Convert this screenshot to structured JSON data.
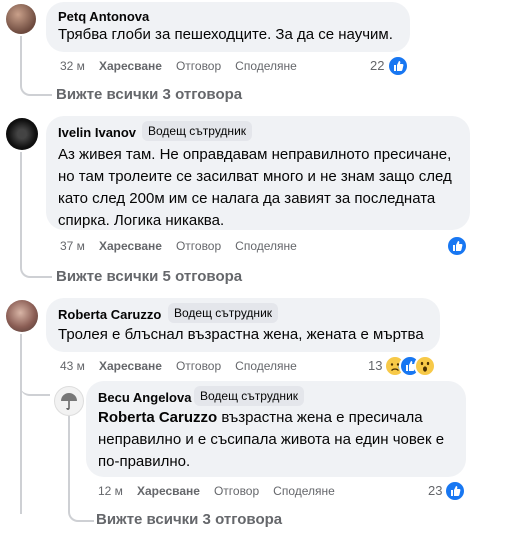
{
  "comments": [
    {
      "author": "Petq Antonova",
      "text": "Трябва глоби за пешеходците. За да се научим.",
      "time": "32 м",
      "like": "Харесване",
      "reply": "Отговор",
      "share": "Споделяне",
      "reactions_count": "22",
      "view_replies": "Вижте всички 3 отговора"
    },
    {
      "author": "Ivelin Ivanov",
      "badge": "Водещ сътрудник",
      "text": "Аз живея там. Не оправдавам неправилното пресичане, но там тролеите се засилват много и не знам защо след като след 200м им се налага да завият за последната спирка. Логика никаква.",
      "time": "37 м",
      "like": "Харесване",
      "reply": "Отговор",
      "share": "Споделяне",
      "view_replies": "Вижте всички 5 отговора"
    },
    {
      "author": "Roberta Caruzzo",
      "badge": "Водещ сътрудник",
      "text": "Тролея е блъснал възрастна жена, жената е мъртва",
      "time": "43 м",
      "like": "Харесване",
      "reply": "Отговор",
      "share": "Споделяне",
      "reactions_count": "13"
    },
    {
      "author": "Becu Angelova",
      "badge": "Водещ сътрудник",
      "mention": "Roberta Caruzzo",
      "text": " възрастна жена е пресичала неправилно и е съсипала живота на един човек е по-правилно.",
      "time": "12 м",
      "like": "Харесване",
      "reply": "Отговор",
      "share": "Споделяне",
      "reactions_count": "23",
      "view_replies": "Вижте всички 3 отговора"
    }
  ],
  "colors": {
    "like_blue": "#1877f2",
    "meta_gray": "#65676b",
    "bubble_bg": "#f0f2f5"
  }
}
